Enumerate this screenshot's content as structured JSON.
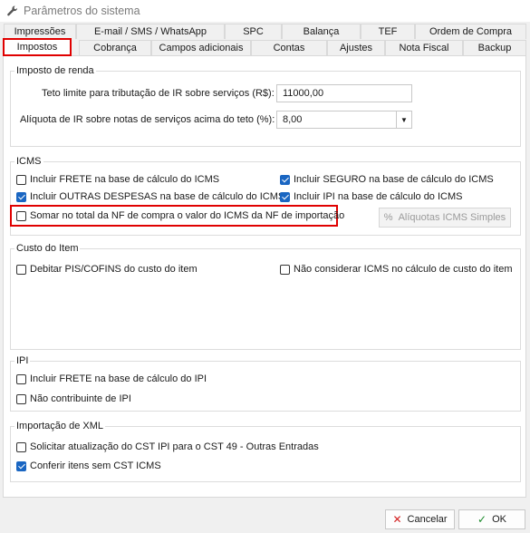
{
  "window": {
    "title": "Parâmetros do sistema",
    "icon": "wrench-icon"
  },
  "tabs_row1": [
    "Impressões",
    "E-mail / SMS / WhatsApp",
    "SPC",
    "Balança",
    "TEF",
    "Ordem de Compra"
  ],
  "tabs_row2": [
    "Impostos",
    "Cobrança",
    "Campos adicionais",
    "Contas",
    "Ajustes",
    "Nota Fiscal",
    "Backup"
  ],
  "active_tab": "Impostos",
  "imposto_renda": {
    "title": "Imposto de renda",
    "teto_label": "Teto limite para tributação de IR sobre serviços (R$):",
    "teto_value": "11000,00",
    "aliquota_label": "Alíquota de IR sobre notas de serviços acima do teto (%):",
    "aliquota_value": "8,00"
  },
  "icms": {
    "title": "ICMS",
    "items": [
      {
        "label": "Incluir FRETE na base de cálculo do ICMS",
        "checked": false
      },
      {
        "label": "Incluir SEGURO na base de cálculo do ICMS",
        "checked": true
      },
      {
        "label": "Incluir OUTRAS DESPESAS na base de cálculo do ICMS",
        "checked": true
      },
      {
        "label": "Incluir IPI na base de cálculo do ICMS",
        "checked": true
      },
      {
        "label": "Somar no total da NF de compra o valor do ICMS da NF de importação",
        "checked": false
      }
    ],
    "aliquotas_button": "Alíquotas ICMS Simples"
  },
  "custo_item": {
    "title": "Custo do Item",
    "items": [
      {
        "label": "Debitar PIS/COFINS do custo do item",
        "checked": false
      },
      {
        "label": "Não considerar ICMS no cálculo de custo do item",
        "checked": false
      }
    ]
  },
  "ipi": {
    "title": "IPI",
    "items": [
      {
        "label": "Incluir FRETE na base de cálculo do IPI",
        "checked": false
      },
      {
        "label": "Não contribuinte de IPI",
        "checked": false
      }
    ]
  },
  "xml": {
    "title": "Importação de XML",
    "items": [
      {
        "label": "Solicitar atualização do CST IPI para o CST 49 - Outras Entradas",
        "checked": false
      },
      {
        "label": "Conferir itens sem CST ICMS",
        "checked": true
      }
    ]
  },
  "footer": {
    "cancel_label": "Cancelar",
    "ok_label": "OK"
  }
}
